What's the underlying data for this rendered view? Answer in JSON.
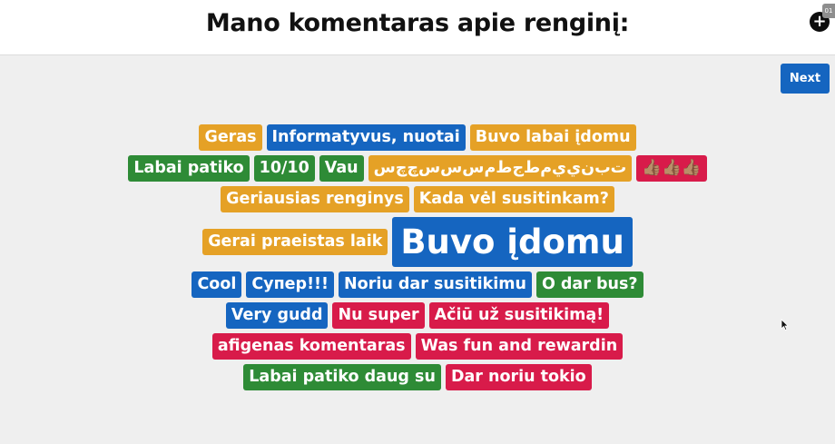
{
  "header": {
    "title": "Mano komentaras apie renginį:",
    "add_button_label": "+",
    "corner_tab_label": "01"
  },
  "controls": {
    "next_label": "Next"
  },
  "colors": {
    "orange": "#e5a126",
    "blue": "#1565c0",
    "green": "#2e8b36",
    "red": "#d81b4a"
  },
  "word_cloud": {
    "rows": [
      [
        {
          "text": "Geras",
          "color": "orange"
        },
        {
          "text": "Informatyvus, nuotai",
          "color": "blue"
        },
        {
          "text": "Buvo labai įdomu",
          "color": "orange"
        }
      ],
      [
        {
          "text": "Labai patiko",
          "color": "green"
        },
        {
          "text": "10/10",
          "color": "green"
        },
        {
          "text": "Vau",
          "color": "green"
        },
        {
          "text": "ﺕﺏﻥﻱﻱﻡﻁﺝﻁﻡﺱﺱﺱﭺﭺﺱ",
          "color": "orange"
        },
        {
          "text": "👍🏽👍🏽👍🏽",
          "color": "red"
        }
      ],
      [
        {
          "text": "Geriausias renginys",
          "color": "orange"
        },
        {
          "text": "Kada vėl susitinkam?",
          "color": "orange"
        }
      ],
      [
        {
          "text": "Gerai praeistas laik",
          "color": "orange"
        },
        {
          "text": "Buvo įdomu",
          "color": "blue",
          "size": "big"
        }
      ],
      [
        {
          "text": "Cool",
          "color": "blue"
        },
        {
          "text": "Супер!!!",
          "color": "blue"
        },
        {
          "text": "Noriu dar susitikimu",
          "color": "blue"
        },
        {
          "text": "O dar bus?",
          "color": "green"
        }
      ],
      [
        {
          "text": "Very gudd",
          "color": "blue"
        },
        {
          "text": "Nu super",
          "color": "red"
        },
        {
          "text": "Ačiū už susitikimą!",
          "color": "red"
        }
      ],
      [
        {
          "text": "afigenas komentaras",
          "color": "red"
        },
        {
          "text": "Was fun and rewardin",
          "color": "red"
        }
      ],
      [
        {
          "text": "Labai patiko daug su",
          "color": "green"
        },
        {
          "text": "Dar noriu tokio",
          "color": "red"
        }
      ]
    ]
  }
}
